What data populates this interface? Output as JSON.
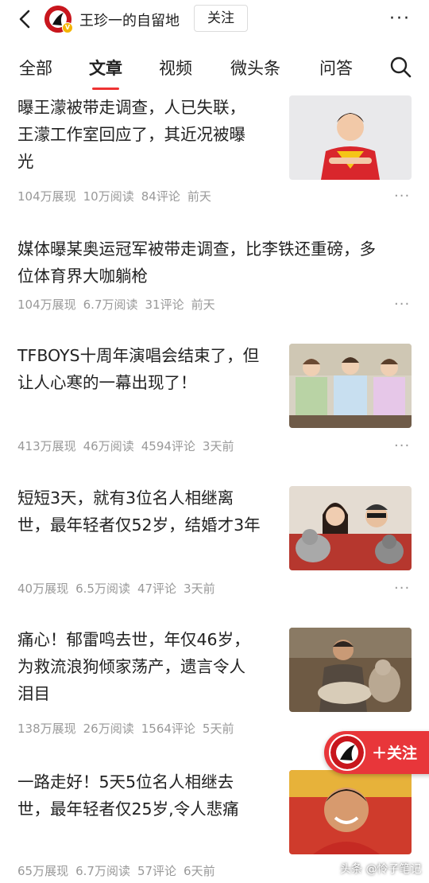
{
  "header": {
    "account_name": "王珍一的自留地",
    "follow_label": "关注",
    "avatar_badge": "V"
  },
  "tabs": [
    {
      "label": "全部"
    },
    {
      "label": "文章"
    },
    {
      "label": "视频"
    },
    {
      "label": "微头条"
    },
    {
      "label": "问答"
    }
  ],
  "articles": [
    {
      "title_lines": [
        "曝王濛被带走调查，人已失联，",
        "王濛工作室回应了，其近况被曝",
        "光"
      ],
      "views": "104万展现",
      "reads": "10万阅读",
      "comments": "84评论",
      "time": "前天",
      "has_thumb": true
    },
    {
      "title_lines": [
        "媒体曝某奥运冠军被带走调查，比李铁还重磅，多",
        "位体育界大咖躺枪"
      ],
      "views": "104万展现",
      "reads": "6.7万阅读",
      "comments": "31评论",
      "time": "前天",
      "has_thumb": false
    },
    {
      "title_lines": [
        "TFBOYS十周年演唱会结束了，但",
        "让人心寒的一幕出现了！"
      ],
      "views": "413万展现",
      "reads": "46万阅读",
      "comments": "4594评论",
      "time": "3天前",
      "has_thumb": true
    },
    {
      "title_lines": [
        "短短3天，就有3位名人相继离",
        "世，最年轻者仅52岁，结婚才3年"
      ],
      "views": "40万展现",
      "reads": "6.5万阅读",
      "comments": "47评论",
      "time": "3天前",
      "has_thumb": true
    },
    {
      "title_lines": [
        "痛心！郁雷鸣去世，年仅46岁，",
        "为救流浪狗倾家荡产，遗言令人",
        "泪目"
      ],
      "views": "138万展现",
      "reads": "26万阅读",
      "comments": "1564评论",
      "time": "5天前",
      "has_thumb": true
    },
    {
      "title_lines": [
        "一路走好！5天5位名人相继去",
        "世，最年轻者仅25岁,令人悲痛"
      ],
      "views": "65万展现",
      "reads": "6.7万阅读",
      "comments": "57评论",
      "time": "6天前",
      "has_thumb": true
    }
  ],
  "float_follow": {
    "label": "＋关注"
  },
  "watermark": "头条 @怜子笔记",
  "colors": {
    "accent": "#e8363a",
    "meta": "#999999",
    "text": "#222222"
  }
}
